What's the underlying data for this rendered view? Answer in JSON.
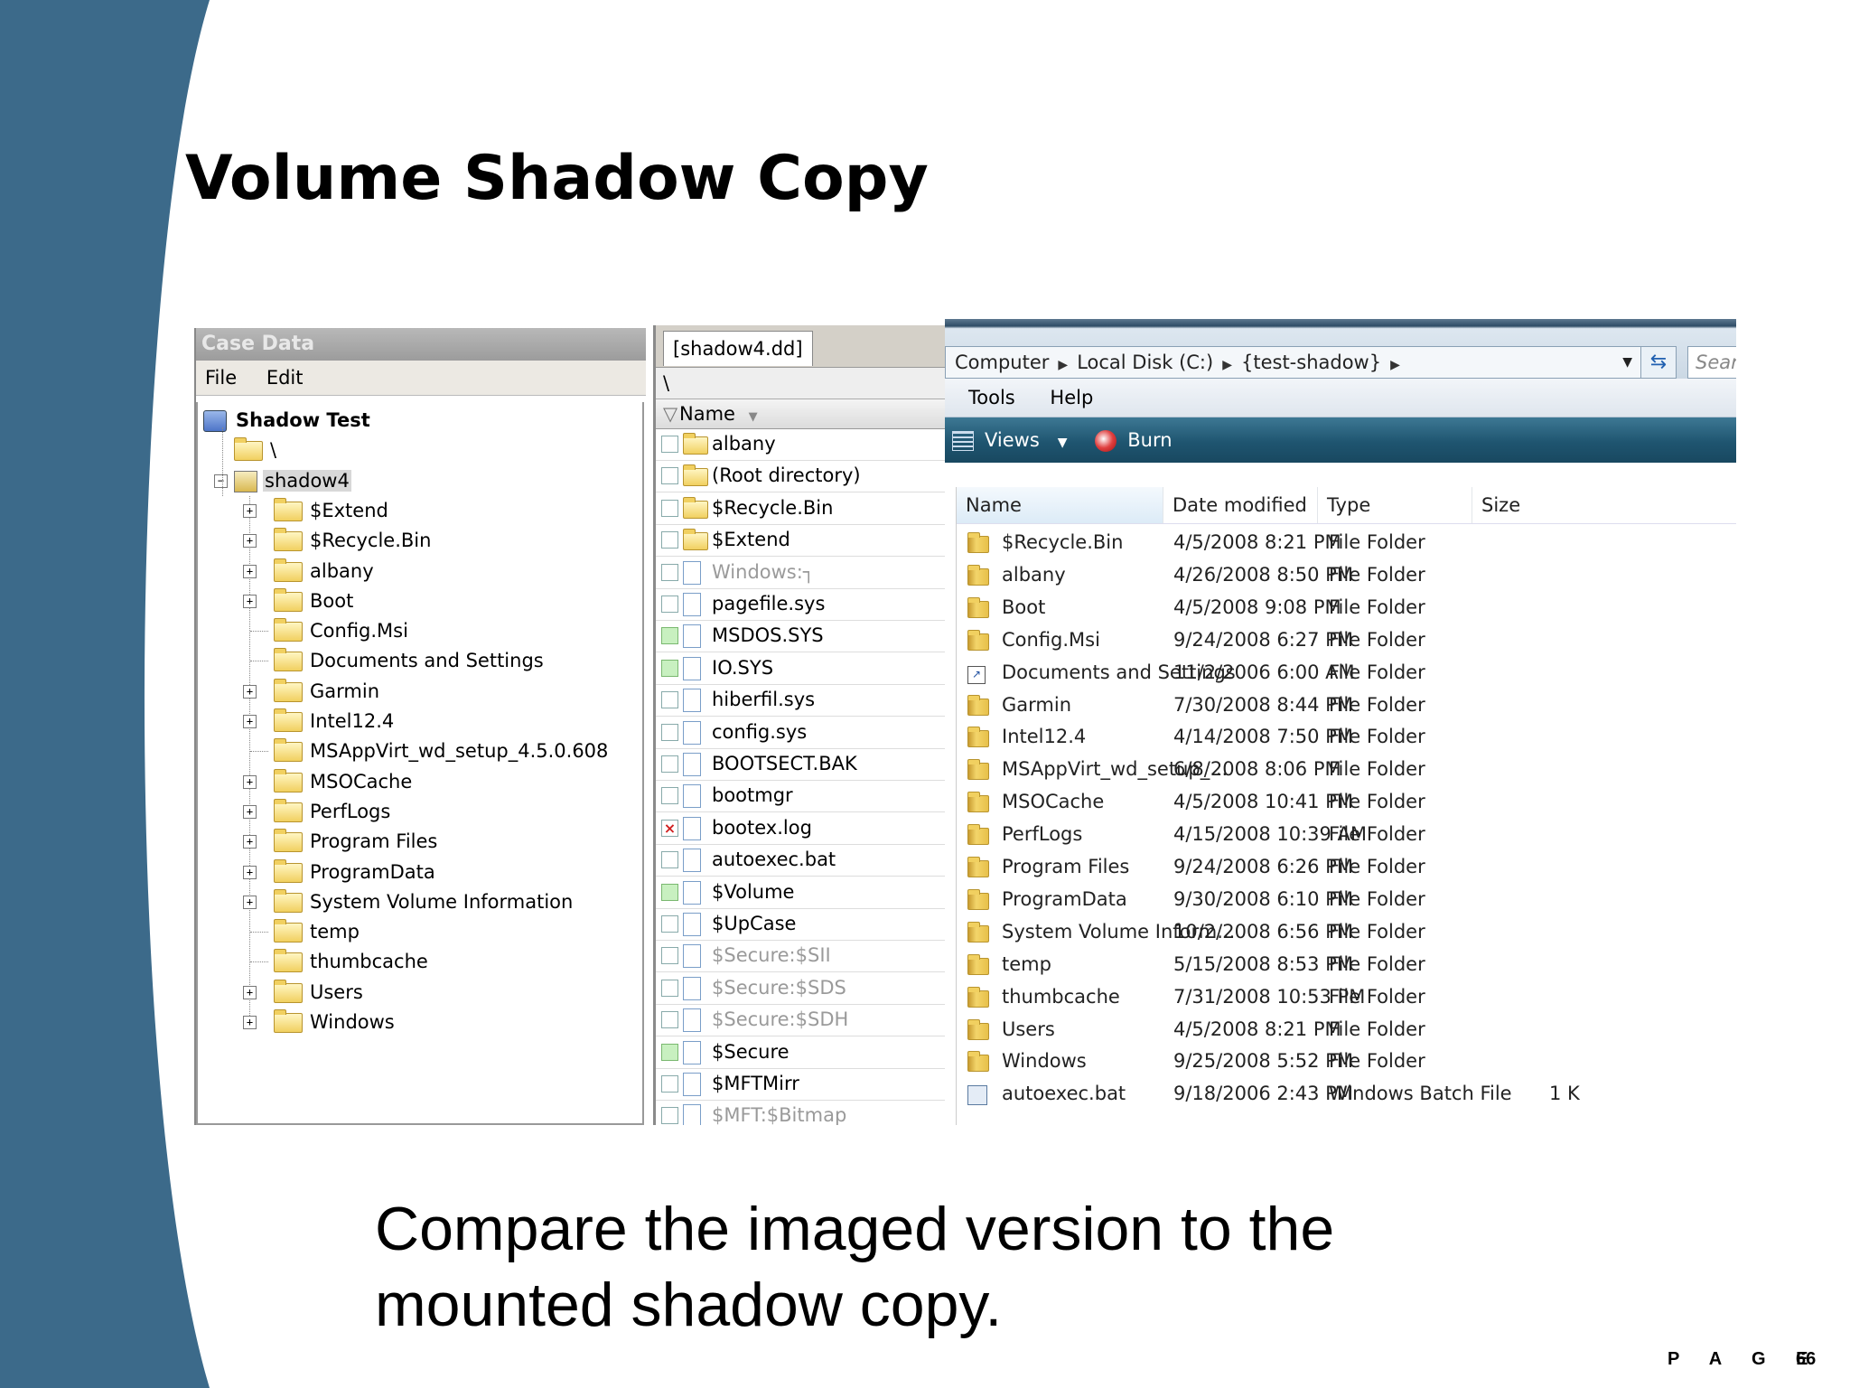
{
  "slide": {
    "title": "Volume Shadow Copy",
    "caption": "Compare the imaged version to the mounted shadow copy.",
    "page_label": "P A G E",
    "page_number": "66",
    "band_color": "#3c6a8a"
  },
  "case_panel": {
    "title": "Case Data",
    "menu": [
      "File",
      "Edit"
    ],
    "root": "Shadow Test",
    "root_child": "\\",
    "volume": "shadow4",
    "items": [
      {
        "label": "$Extend",
        "expandable": true
      },
      {
        "label": "$Recycle.Bin",
        "expandable": true
      },
      {
        "label": "albany",
        "expandable": true
      },
      {
        "label": "Boot",
        "expandable": true
      },
      {
        "label": "Config.Msi",
        "expandable": false
      },
      {
        "label": "Documents and Settings",
        "expandable": false
      },
      {
        "label": "Garmin",
        "expandable": true
      },
      {
        "label": "Intel12.4",
        "expandable": true
      },
      {
        "label": "MSAppVirt_wd_setup_4.5.0.608",
        "expandable": false
      },
      {
        "label": "MSOCache",
        "expandable": true
      },
      {
        "label": "PerfLogs",
        "expandable": true
      },
      {
        "label": "Program Files",
        "expandable": true
      },
      {
        "label": "ProgramData",
        "expandable": true
      },
      {
        "label": "System Volume Information",
        "expandable": true
      },
      {
        "label": "temp",
        "expandable": false
      },
      {
        "label": "thumbcache",
        "expandable": false
      },
      {
        "label": "Users",
        "expandable": true
      },
      {
        "label": "Windows",
        "expandable": true
      }
    ]
  },
  "list_panel": {
    "tab": "[shadow4.dd]",
    "path": "\\",
    "column": "Name",
    "rows": [
      {
        "name": "albany",
        "kind": "folder",
        "check": "none",
        "muted": false
      },
      {
        "name": "(Root directory)",
        "kind": "folder",
        "check": "none",
        "muted": false
      },
      {
        "name": "$Recycle.Bin",
        "kind": "folder",
        "check": "none",
        "muted": false
      },
      {
        "name": "$Extend",
        "kind": "folder",
        "check": "none",
        "muted": false
      },
      {
        "name": "Windows:┐",
        "kind": "file",
        "check": "none",
        "muted": true
      },
      {
        "name": "pagefile.sys",
        "kind": "file",
        "check": "none",
        "muted": false
      },
      {
        "name": "MSDOS.SYS",
        "kind": "file",
        "check": "green",
        "muted": false
      },
      {
        "name": "IO.SYS",
        "kind": "file",
        "check": "green",
        "muted": false
      },
      {
        "name": "hiberfil.sys",
        "kind": "file",
        "check": "none",
        "muted": false
      },
      {
        "name": "config.sys",
        "kind": "file",
        "check": "none",
        "muted": false
      },
      {
        "name": "BOOTSECT.BAK",
        "kind": "file",
        "check": "none",
        "muted": false
      },
      {
        "name": "bootmgr",
        "kind": "file",
        "check": "none",
        "muted": false
      },
      {
        "name": "bootex.log",
        "kind": "file",
        "check": "x",
        "muted": false
      },
      {
        "name": "autoexec.bat",
        "kind": "file",
        "check": "none",
        "muted": false
      },
      {
        "name": "$Volume",
        "kind": "file",
        "check": "green",
        "muted": false
      },
      {
        "name": "$UpCase",
        "kind": "file",
        "check": "none",
        "muted": false
      },
      {
        "name": "$Secure:$SII",
        "kind": "file",
        "check": "none",
        "muted": true
      },
      {
        "name": "$Secure:$SDS",
        "kind": "file",
        "check": "none",
        "muted": true
      },
      {
        "name": "$Secure:$SDH",
        "kind": "file",
        "check": "none",
        "muted": true
      },
      {
        "name": "$Secure",
        "kind": "file",
        "check": "green",
        "muted": false
      },
      {
        "name": "$MFTMirr",
        "kind": "file",
        "check": "none",
        "muted": false
      },
      {
        "name": "$MFT:$Bitmap",
        "kind": "file",
        "check": "none",
        "muted": true
      }
    ]
  },
  "explorer": {
    "breadcrumb": [
      "Computer",
      "Local Disk (C:)",
      "{test-shadow}"
    ],
    "search_placeholder": "Sear",
    "menu": [
      "Tools",
      "Help"
    ],
    "toolbar": {
      "views": "Views",
      "burn": "Burn"
    },
    "columns": [
      "Name",
      "Date modified",
      "Type",
      "Size"
    ],
    "rows": [
      {
        "name": "$Recycle.Bin",
        "date": "4/5/2008 8:21 PM",
        "type": "File Folder",
        "size": "",
        "icon": "folder"
      },
      {
        "name": "albany",
        "date": "4/26/2008 8:50 PM",
        "type": "File Folder",
        "size": "",
        "icon": "folder"
      },
      {
        "name": "Boot",
        "date": "4/5/2008 9:08 PM",
        "type": "File Folder",
        "size": "",
        "icon": "folder"
      },
      {
        "name": "Config.Msi",
        "date": "9/24/2008 6:27 PM",
        "type": "File Folder",
        "size": "",
        "icon": "folder"
      },
      {
        "name": "Documents and Settings",
        "date": "11/2/2006 6:00 AM",
        "type": "File Folder",
        "size": "",
        "icon": "shortcut"
      },
      {
        "name": "Garmin",
        "date": "7/30/2008 8:44 PM",
        "type": "File Folder",
        "size": "",
        "icon": "folder"
      },
      {
        "name": "Intel12.4",
        "date": "4/14/2008 7:50 PM",
        "type": "File Folder",
        "size": "",
        "icon": "folder"
      },
      {
        "name": "MSAppVirt_wd_setup_...",
        "date": "6/8/2008 8:06 PM",
        "type": "File Folder",
        "size": "",
        "icon": "folder"
      },
      {
        "name": "MSOCache",
        "date": "4/5/2008 10:41 PM",
        "type": "File Folder",
        "size": "",
        "icon": "folder"
      },
      {
        "name": "PerfLogs",
        "date": "4/15/2008 10:39 AM",
        "type": "File Folder",
        "size": "",
        "icon": "folder"
      },
      {
        "name": "Program Files",
        "date": "9/24/2008 6:26 PM",
        "type": "File Folder",
        "size": "",
        "icon": "folder"
      },
      {
        "name": "ProgramData",
        "date": "9/30/2008 6:10 PM",
        "type": "File Folder",
        "size": "",
        "icon": "folder"
      },
      {
        "name": "System Volume Inform...",
        "date": "10/2/2008 6:56 PM",
        "type": "File Folder",
        "size": "",
        "icon": "folder"
      },
      {
        "name": "temp",
        "date": "5/15/2008 8:53 PM",
        "type": "File Folder",
        "size": "",
        "icon": "folder"
      },
      {
        "name": "thumbcache",
        "date": "7/31/2008 10:53 PM",
        "type": "File Folder",
        "size": "",
        "icon": "folder"
      },
      {
        "name": "Users",
        "date": "4/5/2008 8:21 PM",
        "type": "File Folder",
        "size": "",
        "icon": "folder"
      },
      {
        "name": "Windows",
        "date": "9/25/2008 5:52 PM",
        "type": "File Folder",
        "size": "",
        "icon": "folder"
      },
      {
        "name": "autoexec.bat",
        "date": "9/18/2006 2:43 PM",
        "type": "Windows Batch File",
        "size": "1 K",
        "icon": "bat"
      }
    ]
  }
}
